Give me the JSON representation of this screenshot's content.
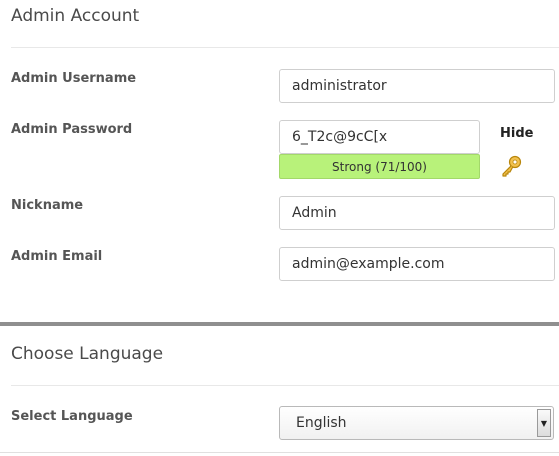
{
  "admin_account": {
    "title": "Admin Account",
    "username_label": "Admin Username",
    "username_value": "administrator",
    "password_label": "Admin Password",
    "password_value": "6_T2c@9cC[x",
    "strength_text": "Strong (71/100)",
    "strength_color": "#b8f27a",
    "hide_label": "Hide",
    "key_icon": "key-icon",
    "nickname_label": "Nickname",
    "nickname_value": "Admin",
    "email_label": "Admin Email",
    "email_value": "admin@example.com"
  },
  "language": {
    "title": "Choose Language",
    "select_label": "Select Language",
    "selected_value": "English"
  }
}
